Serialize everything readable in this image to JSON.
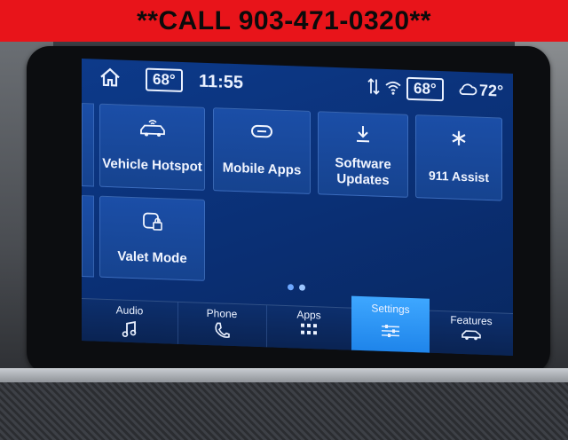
{
  "banner": {
    "text": "**CALL 903-471-0320**"
  },
  "status": {
    "cabin_temp_left": "68°",
    "time": "11:55",
    "cabin_temp_right": "68°",
    "outside_temp": "72°",
    "icons": [
      "home-icon",
      "signal-icon",
      "wifi-icon",
      "weather-icon"
    ]
  },
  "tiles": [
    {
      "label": "Vehicle Hotspot",
      "icon": "car-hotspot-icon"
    },
    {
      "label": "Mobile Apps",
      "icon": "link-icon"
    },
    {
      "label": "Software\nUpdates",
      "label_line1": "Software",
      "label_line2": "Updates",
      "icon": "download-icon"
    },
    {
      "label": "911 Assist",
      "icon": "asterisk-icon"
    },
    {
      "label": "Valet Mode",
      "icon": "lock-icon"
    }
  ],
  "pager": {
    "pages": 2,
    "current": 2
  },
  "nav": [
    {
      "label": "Audio",
      "icon": "music-note-icon"
    },
    {
      "label": "Phone",
      "icon": "phone-icon"
    },
    {
      "label": "Apps",
      "icon": "apps-grid-icon"
    },
    {
      "label": "Settings",
      "icon": "sliders-icon",
      "active": true
    },
    {
      "label": "Features",
      "icon": "car-icon"
    }
  ],
  "colors": {
    "banner_bg": "#e8141a",
    "screen_bg": "#0a2f74",
    "tile_bg": "#1b4ea7",
    "active_tab": "#2d97f5",
    "text": "#eaf1ff"
  }
}
